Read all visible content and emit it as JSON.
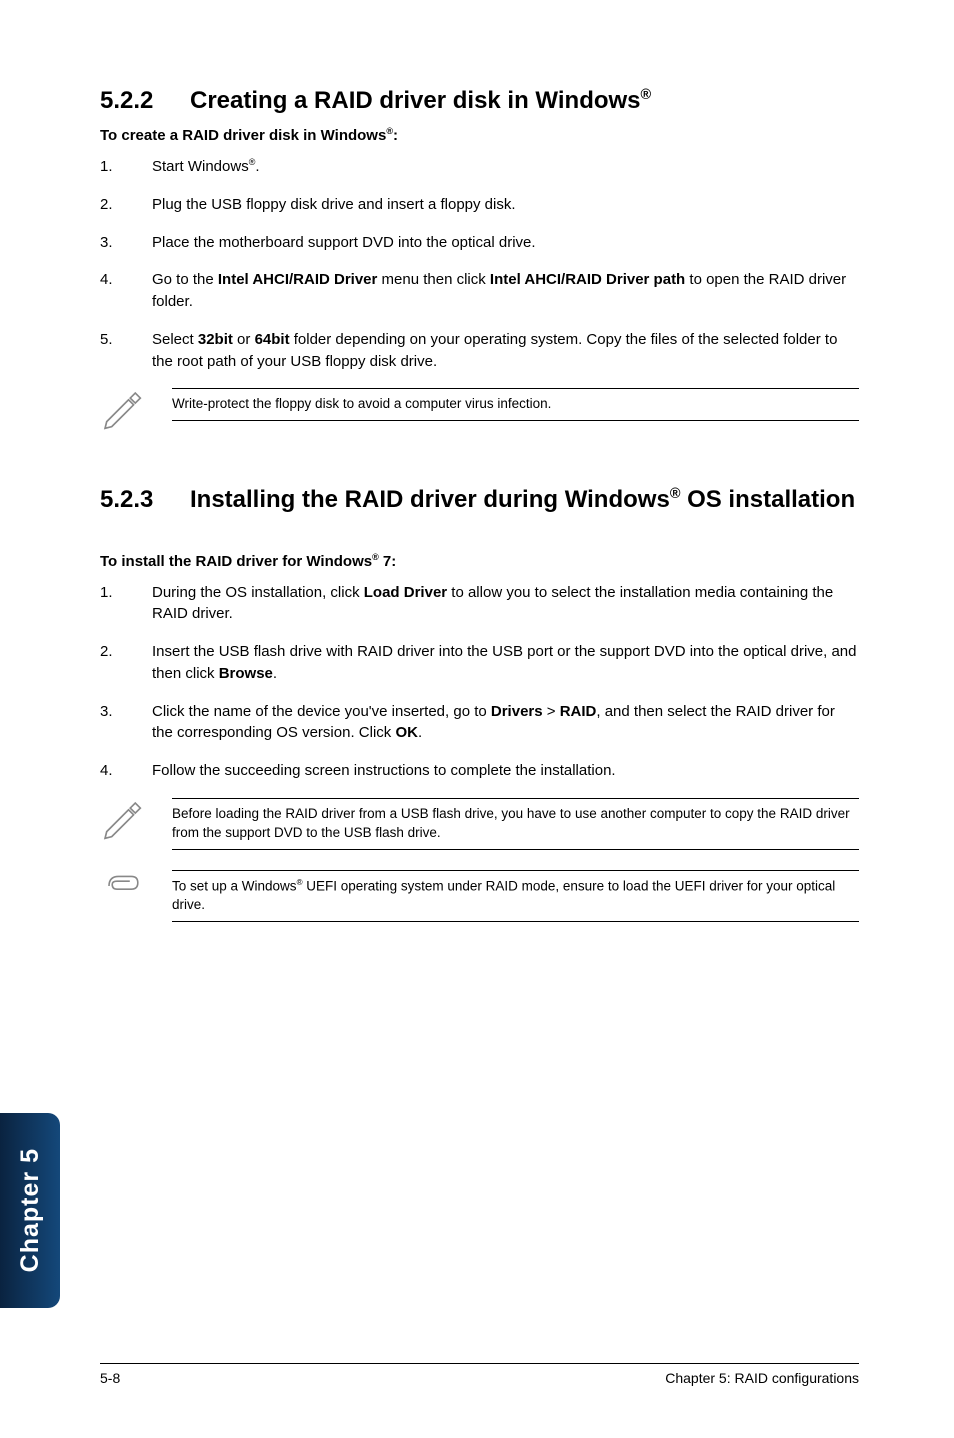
{
  "sec522": {
    "num": "5.2.2",
    "title_a": "Creating a RAID driver disk in Windows",
    "title_sup": "®",
    "sub_a": "To create a RAID driver disk in Windows",
    "sub_b": ":",
    "steps": [
      {
        "n": "1.",
        "a": "Start Windows",
        "sup": "®",
        "b": "."
      },
      {
        "n": "2.",
        "a": "Plug the USB floppy disk drive and insert a floppy disk."
      },
      {
        "n": "3.",
        "a": "Place the motherboard support DVD into the optical drive."
      },
      {
        "n": "4.",
        "a": "Go to the ",
        "bold1": "Intel AHCI/RAID Driver",
        "b": " menu then click ",
        "bold2": "Intel AHCI/RAID Driver path",
        "c": " to open the RAID driver folder."
      },
      {
        "n": "5.",
        "a": "Select ",
        "bold1": "32bit",
        "b": " or ",
        "bold2": "64bit",
        "c": " folder depending on your operating system. Copy the files of the selected folder to the root path of your USB floppy disk drive."
      }
    ],
    "note": "Write-protect the floppy disk to avoid a computer virus infection."
  },
  "sec523": {
    "num": "5.2.3",
    "title_a": "Installing the RAID driver during Windows",
    "title_sup": "®",
    "title_b": " OS installation",
    "sub_a": "To install the RAID driver for Windows",
    "sub_sup": "®",
    "sub_b": " 7:",
    "steps": [
      {
        "n": "1.",
        "a": "During the OS installation, click ",
        "bold1": "Load Driver",
        "b": " to allow you to select the installation media containing the RAID driver."
      },
      {
        "n": "2.",
        "a": "Insert the USB flash drive with RAID driver into the USB port or the support DVD into the optical drive, and then click ",
        "bold1": "Browse",
        "b": "."
      },
      {
        "n": "3.",
        "a": "Click the name of the device you've inserted, go to ",
        "bold1": "Drivers",
        "b": " > ",
        "bold2": "RAID",
        "c": ", and then select the RAID driver for the corresponding OS version. Click ",
        "bold3": "OK",
        "d": "."
      },
      {
        "n": "4.",
        "a": "Follow the succeeding screen instructions to complete the installation."
      }
    ],
    "note1": "Before loading the RAID driver from a USB flash drive, you have to use another computer to copy the RAID driver from the support DVD to the USB flash drive.",
    "note2_a": "To set up a Windows",
    "note2_sup": "®",
    "note2_b": " UEFI operating system under RAID mode, ensure to load the UEFI driver for your optical drive."
  },
  "sidebar": "Chapter 5",
  "footer": {
    "left": "5-8",
    "right": "Chapter 5: RAID configurations"
  },
  "icons": {
    "pencil": "pencil-icon",
    "clip": "paperclip-icon"
  }
}
